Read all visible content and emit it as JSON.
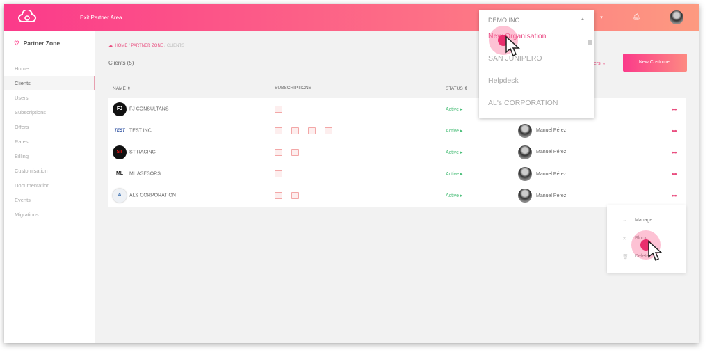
{
  "header": {
    "exit_label": "Exit Partner Area",
    "org_toggle": "▾",
    "bell_icon": "bell-icon"
  },
  "sidebar": {
    "title": "Partner Zone",
    "items": [
      {
        "label": "Home"
      },
      {
        "label": "Clients",
        "active": true
      },
      {
        "label": "Users"
      },
      {
        "label": "Subscriptions"
      },
      {
        "label": "Offers"
      },
      {
        "label": "Rates"
      },
      {
        "label": "Billing"
      },
      {
        "label": "Customisation"
      },
      {
        "label": "Documentation"
      },
      {
        "label": "Events"
      },
      {
        "label": "Migrations"
      }
    ]
  },
  "breadcrumb": [
    "HOME",
    "PARTNER ZONE",
    "CLIENTS"
  ],
  "main": {
    "title": "Clients (5)",
    "filters_label": "ters ⌄",
    "new_customer_label": "New Customer"
  },
  "table": {
    "columns": [
      "NAME ⇕",
      "SUBSCRIPTIONS",
      "STATUS ⇕"
    ],
    "rows": [
      {
        "logo": "FJ",
        "name": "FJ CONSULTANS",
        "subscriptions": 1,
        "status": "Active ▸",
        "owner": ""
      },
      {
        "logo": "TEST",
        "name": "TEST INC",
        "subscriptions": 4,
        "status": "Active ▸",
        "owner": "Manuel Pérez"
      },
      {
        "logo": "ST",
        "name": "ST RACING",
        "subscriptions": 2,
        "status": "Active ▸",
        "owner": "Manuel Pérez"
      },
      {
        "logo": "ML",
        "name": "ML ASESORS",
        "subscriptions": 1,
        "status": "Active ▸",
        "owner": "Manuel Pérez"
      },
      {
        "logo": "A",
        "name": "AL's CORPORATION",
        "subscriptions": 2,
        "status": "Active ▸",
        "owner": "Manuel Pérez"
      }
    ]
  },
  "org_dropdown": {
    "current": "DEMO INC",
    "options": [
      "New Organisation",
      "SAN JUNIPERO",
      "Helpdesk",
      "AL's CORPORATION"
    ]
  },
  "row_menu": {
    "items": [
      {
        "icon": "arrow-right-icon",
        "label": "Manage"
      },
      {
        "icon": "close-icon",
        "label": "Block"
      },
      {
        "icon": "trash-icon",
        "label": "Delete"
      }
    ]
  },
  "colors": {
    "accent": "#fb3a8a",
    "status_active": "#4cbf7a"
  }
}
